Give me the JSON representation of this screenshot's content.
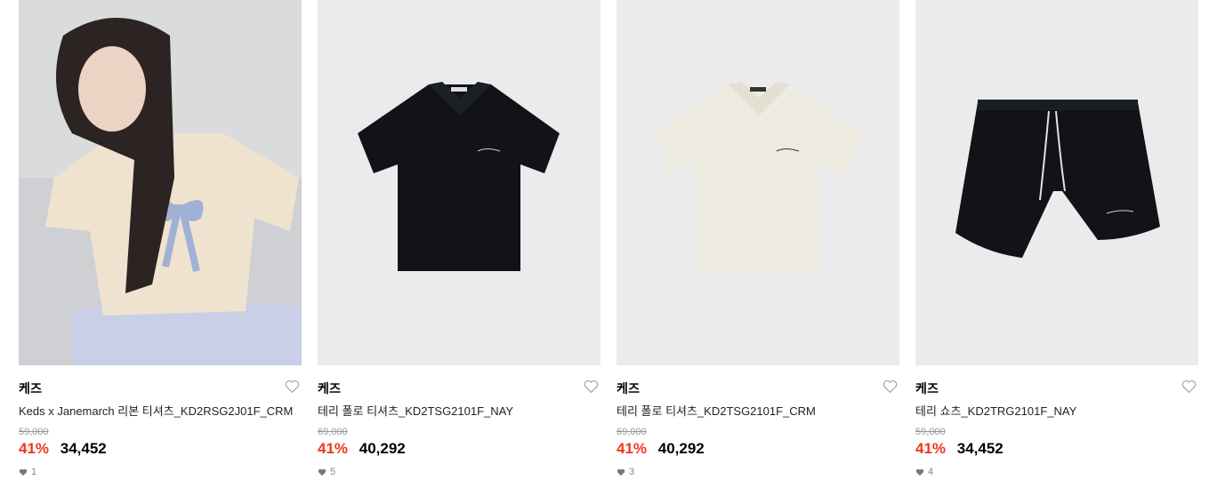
{
  "products": [
    {
      "brand": "케즈",
      "name": "Keds x Janemarch 리본 티셔츠_KD2RSG2J01F_CRM",
      "original_price": "59,000",
      "discount": "41%",
      "price": "34,452",
      "likes": "1"
    },
    {
      "brand": "케즈",
      "name": "테리 폴로 티셔츠_KD2TSG2101F_NAY",
      "original_price": "69,000",
      "discount": "41%",
      "price": "40,292",
      "likes": "5"
    },
    {
      "brand": "케즈",
      "name": "테리 폴로 티셔츠_KD2TSG2101F_CRM",
      "original_price": "69,000",
      "discount": "41%",
      "price": "40,292",
      "likes": "3"
    },
    {
      "brand": "케즈",
      "name": "테리 쇼츠_KD2TRG2101F_NAY",
      "original_price": "59,000",
      "discount": "41%",
      "price": "34,452",
      "likes": "4"
    }
  ],
  "icons": {
    "wishlist": "heart-outline-icon",
    "likes": "heart-filled-icon"
  },
  "colors": {
    "discount": "#f0361b",
    "image_bg": "#ebebeb"
  }
}
